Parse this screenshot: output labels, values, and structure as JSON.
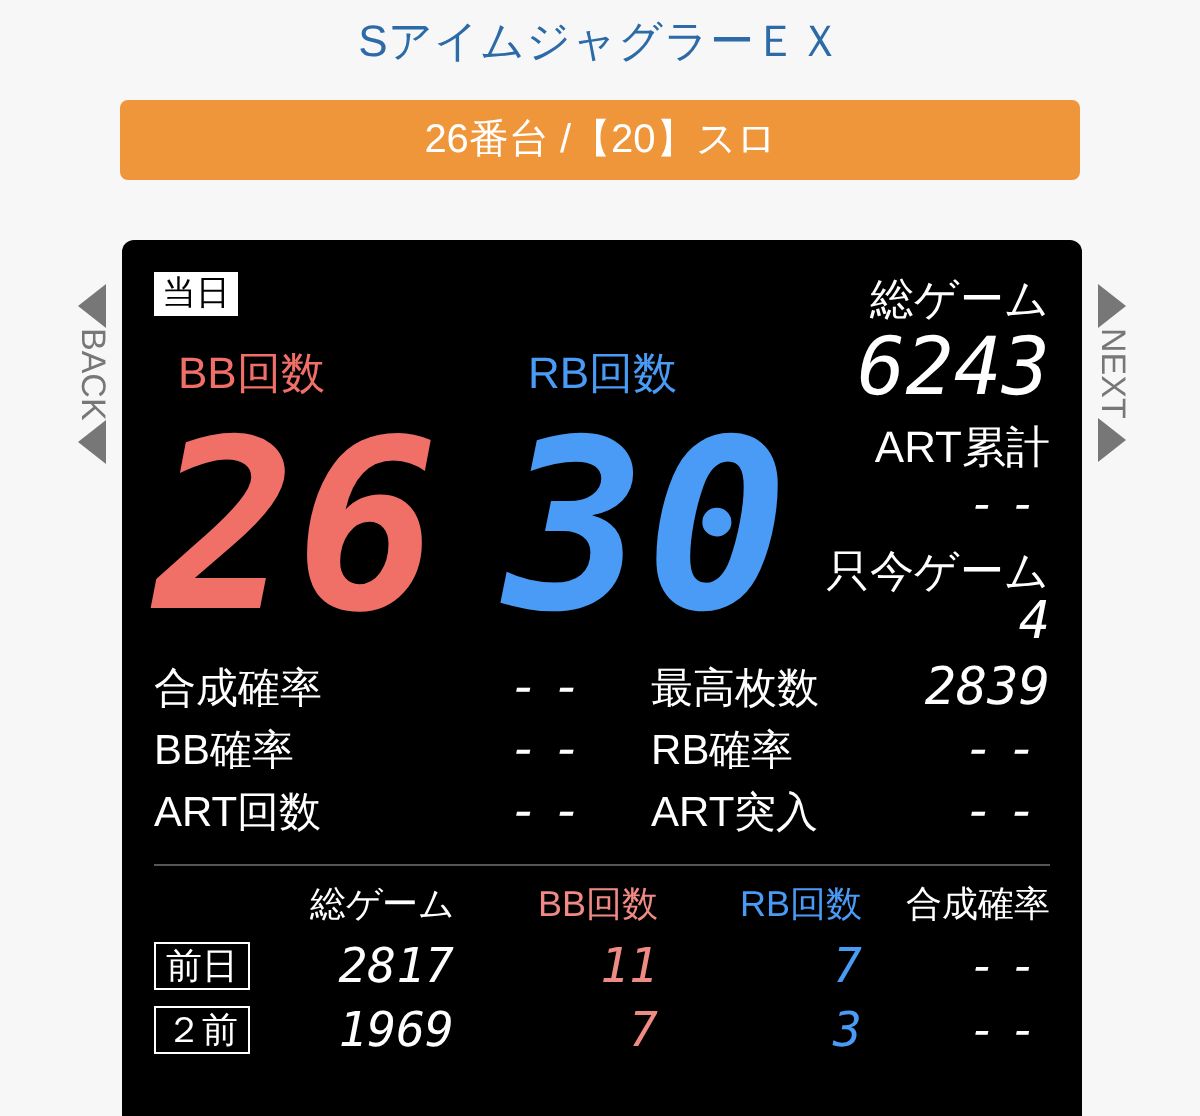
{
  "title": "SアイムジャグラーＥＸ",
  "machine": "26番台 /【20】スロ",
  "nav": {
    "back": "BACK",
    "next": "NEXT"
  },
  "today": {
    "badge": "当日",
    "bb_label": "BB回数",
    "bb": "26",
    "rb_label": "RB回数",
    "rb": "30",
    "side": [
      {
        "label": "総ゲーム",
        "value": "6243",
        "kind": "digits"
      },
      {
        "label": "ART累計",
        "value": "--",
        "kind": "dash"
      },
      {
        "label": "只今ゲーム",
        "value": "4",
        "kind": "digits"
      }
    ]
  },
  "stats": [
    [
      {
        "label": "合成確率",
        "value": "--"
      },
      {
        "label": "最高枚数",
        "value": "2839"
      }
    ],
    [
      {
        "label": "BB確率",
        "value": "--"
      },
      {
        "label": "RB確率",
        "value": "--"
      }
    ],
    [
      {
        "label": "ART回数",
        "value": "--"
      },
      {
        "label": "ART突入",
        "value": "--"
      }
    ]
  ],
  "history": {
    "columns": [
      "総ゲーム",
      "BB回数",
      "RB回数",
      "合成確率"
    ],
    "rows": [
      {
        "day": "前日",
        "values": [
          "2817",
          "11",
          "7",
          "--"
        ]
      },
      {
        "day": "２前",
        "values": [
          "1969",
          "7",
          "3",
          "--"
        ]
      }
    ]
  }
}
